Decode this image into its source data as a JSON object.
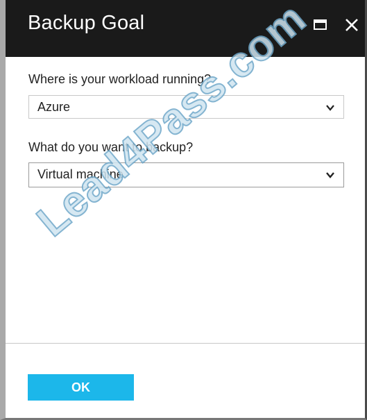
{
  "dialog": {
    "title": "Backup Goal"
  },
  "fields": {
    "workload": {
      "label": "Where is your workload running?",
      "value": "Azure"
    },
    "backup": {
      "label": "What do you want to backup?",
      "value": "Virtual machine"
    }
  },
  "footer": {
    "ok_label": "OK"
  },
  "watermark": {
    "text": "Lead4Pass.com"
  },
  "colors": {
    "titlebar": "#1a1a1a",
    "ok_button": "#1cb7ea"
  },
  "icons": {
    "maximize": "maximize-icon",
    "close": "close-icon",
    "dropdown": "chevron-down-icon"
  }
}
